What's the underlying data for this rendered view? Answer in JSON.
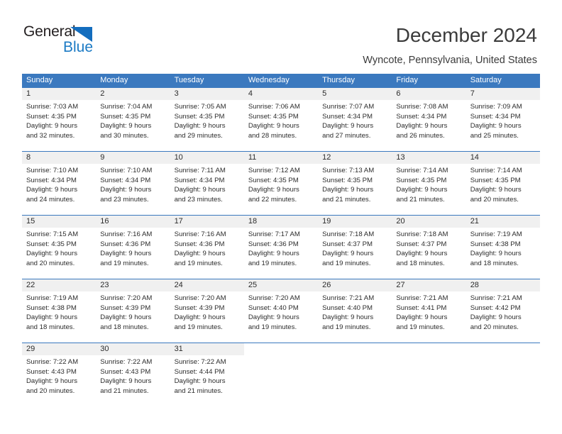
{
  "brand": {
    "name_part1": "General",
    "name_part2": "Blue",
    "triangle_color": "#136dbe",
    "blue_text_color": "#1b7ac4"
  },
  "header": {
    "title": "December 2024",
    "location": "Wyncote, Pennsylvania, United States"
  },
  "theme": {
    "header_blue": "#3b79bf",
    "daynum_band": "#f0f0f0",
    "text": "#2c2c2c"
  },
  "weekdays": [
    "Sunday",
    "Monday",
    "Tuesday",
    "Wednesday",
    "Thursday",
    "Friday",
    "Saturday"
  ],
  "weeks": [
    [
      {
        "day": "1",
        "sunrise": "Sunrise: 7:03 AM",
        "sunset": "Sunset: 4:35 PM",
        "daylight1": "Daylight: 9 hours",
        "daylight2": "and 32 minutes."
      },
      {
        "day": "2",
        "sunrise": "Sunrise: 7:04 AM",
        "sunset": "Sunset: 4:35 PM",
        "daylight1": "Daylight: 9 hours",
        "daylight2": "and 30 minutes."
      },
      {
        "day": "3",
        "sunrise": "Sunrise: 7:05 AM",
        "sunset": "Sunset: 4:35 PM",
        "daylight1": "Daylight: 9 hours",
        "daylight2": "and 29 minutes."
      },
      {
        "day": "4",
        "sunrise": "Sunrise: 7:06 AM",
        "sunset": "Sunset: 4:35 PM",
        "daylight1": "Daylight: 9 hours",
        "daylight2": "and 28 minutes."
      },
      {
        "day": "5",
        "sunrise": "Sunrise: 7:07 AM",
        "sunset": "Sunset: 4:34 PM",
        "daylight1": "Daylight: 9 hours",
        "daylight2": "and 27 minutes."
      },
      {
        "day": "6",
        "sunrise": "Sunrise: 7:08 AM",
        "sunset": "Sunset: 4:34 PM",
        "daylight1": "Daylight: 9 hours",
        "daylight2": "and 26 minutes."
      },
      {
        "day": "7",
        "sunrise": "Sunrise: 7:09 AM",
        "sunset": "Sunset: 4:34 PM",
        "daylight1": "Daylight: 9 hours",
        "daylight2": "and 25 minutes."
      }
    ],
    [
      {
        "day": "8",
        "sunrise": "Sunrise: 7:10 AM",
        "sunset": "Sunset: 4:34 PM",
        "daylight1": "Daylight: 9 hours",
        "daylight2": "and 24 minutes."
      },
      {
        "day": "9",
        "sunrise": "Sunrise: 7:10 AM",
        "sunset": "Sunset: 4:34 PM",
        "daylight1": "Daylight: 9 hours",
        "daylight2": "and 23 minutes."
      },
      {
        "day": "10",
        "sunrise": "Sunrise: 7:11 AM",
        "sunset": "Sunset: 4:34 PM",
        "daylight1": "Daylight: 9 hours",
        "daylight2": "and 23 minutes."
      },
      {
        "day": "11",
        "sunrise": "Sunrise: 7:12 AM",
        "sunset": "Sunset: 4:35 PM",
        "daylight1": "Daylight: 9 hours",
        "daylight2": "and 22 minutes."
      },
      {
        "day": "12",
        "sunrise": "Sunrise: 7:13 AM",
        "sunset": "Sunset: 4:35 PM",
        "daylight1": "Daylight: 9 hours",
        "daylight2": "and 21 minutes."
      },
      {
        "day": "13",
        "sunrise": "Sunrise: 7:14 AM",
        "sunset": "Sunset: 4:35 PM",
        "daylight1": "Daylight: 9 hours",
        "daylight2": "and 21 minutes."
      },
      {
        "day": "14",
        "sunrise": "Sunrise: 7:14 AM",
        "sunset": "Sunset: 4:35 PM",
        "daylight1": "Daylight: 9 hours",
        "daylight2": "and 20 minutes."
      }
    ],
    [
      {
        "day": "15",
        "sunrise": "Sunrise: 7:15 AM",
        "sunset": "Sunset: 4:35 PM",
        "daylight1": "Daylight: 9 hours",
        "daylight2": "and 20 minutes."
      },
      {
        "day": "16",
        "sunrise": "Sunrise: 7:16 AM",
        "sunset": "Sunset: 4:36 PM",
        "daylight1": "Daylight: 9 hours",
        "daylight2": "and 19 minutes."
      },
      {
        "day": "17",
        "sunrise": "Sunrise: 7:16 AM",
        "sunset": "Sunset: 4:36 PM",
        "daylight1": "Daylight: 9 hours",
        "daylight2": "and 19 minutes."
      },
      {
        "day": "18",
        "sunrise": "Sunrise: 7:17 AM",
        "sunset": "Sunset: 4:36 PM",
        "daylight1": "Daylight: 9 hours",
        "daylight2": "and 19 minutes."
      },
      {
        "day": "19",
        "sunrise": "Sunrise: 7:18 AM",
        "sunset": "Sunset: 4:37 PM",
        "daylight1": "Daylight: 9 hours",
        "daylight2": "and 19 minutes."
      },
      {
        "day": "20",
        "sunrise": "Sunrise: 7:18 AM",
        "sunset": "Sunset: 4:37 PM",
        "daylight1": "Daylight: 9 hours",
        "daylight2": "and 18 minutes."
      },
      {
        "day": "21",
        "sunrise": "Sunrise: 7:19 AM",
        "sunset": "Sunset: 4:38 PM",
        "daylight1": "Daylight: 9 hours",
        "daylight2": "and 18 minutes."
      }
    ],
    [
      {
        "day": "22",
        "sunrise": "Sunrise: 7:19 AM",
        "sunset": "Sunset: 4:38 PM",
        "daylight1": "Daylight: 9 hours",
        "daylight2": "and 18 minutes."
      },
      {
        "day": "23",
        "sunrise": "Sunrise: 7:20 AM",
        "sunset": "Sunset: 4:39 PM",
        "daylight1": "Daylight: 9 hours",
        "daylight2": "and 18 minutes."
      },
      {
        "day": "24",
        "sunrise": "Sunrise: 7:20 AM",
        "sunset": "Sunset: 4:39 PM",
        "daylight1": "Daylight: 9 hours",
        "daylight2": "and 19 minutes."
      },
      {
        "day": "25",
        "sunrise": "Sunrise: 7:20 AM",
        "sunset": "Sunset: 4:40 PM",
        "daylight1": "Daylight: 9 hours",
        "daylight2": "and 19 minutes."
      },
      {
        "day": "26",
        "sunrise": "Sunrise: 7:21 AM",
        "sunset": "Sunset: 4:40 PM",
        "daylight1": "Daylight: 9 hours",
        "daylight2": "and 19 minutes."
      },
      {
        "day": "27",
        "sunrise": "Sunrise: 7:21 AM",
        "sunset": "Sunset: 4:41 PM",
        "daylight1": "Daylight: 9 hours",
        "daylight2": "and 19 minutes."
      },
      {
        "day": "28",
        "sunrise": "Sunrise: 7:21 AM",
        "sunset": "Sunset: 4:42 PM",
        "daylight1": "Daylight: 9 hours",
        "daylight2": "and 20 minutes."
      }
    ],
    [
      {
        "day": "29",
        "sunrise": "Sunrise: 7:22 AM",
        "sunset": "Sunset: 4:43 PM",
        "daylight1": "Daylight: 9 hours",
        "daylight2": "and 20 minutes."
      },
      {
        "day": "30",
        "sunrise": "Sunrise: 7:22 AM",
        "sunset": "Sunset: 4:43 PM",
        "daylight1": "Daylight: 9 hours",
        "daylight2": "and 21 minutes."
      },
      {
        "day": "31",
        "sunrise": "Sunrise: 7:22 AM",
        "sunset": "Sunset: 4:44 PM",
        "daylight1": "Daylight: 9 hours",
        "daylight2": "and 21 minutes."
      },
      {
        "day": "",
        "sunrise": "",
        "sunset": "",
        "daylight1": "",
        "daylight2": ""
      },
      {
        "day": "",
        "sunrise": "",
        "sunset": "",
        "daylight1": "",
        "daylight2": ""
      },
      {
        "day": "",
        "sunrise": "",
        "sunset": "",
        "daylight1": "",
        "daylight2": ""
      },
      {
        "day": "",
        "sunrise": "",
        "sunset": "",
        "daylight1": "",
        "daylight2": ""
      }
    ]
  ]
}
